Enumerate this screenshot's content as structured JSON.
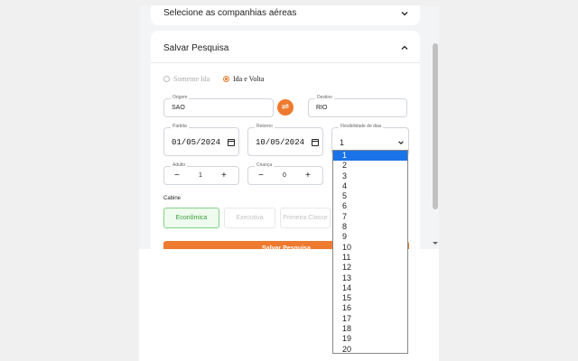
{
  "airlines_section": {
    "title": "Selecione as companhias aéreas"
  },
  "save_section": {
    "title": "Salvar Pesquisa"
  },
  "trip_type": {
    "one_way": "Somente Ida",
    "round_trip": "Ida e Volta",
    "selected": "round_trip"
  },
  "origin": {
    "label": "Origem",
    "value": "SAO"
  },
  "destination": {
    "label": "Destino",
    "value": "RIO"
  },
  "swap_icon": "⇌",
  "departure": {
    "label": "Partida",
    "value": "01/05/2024"
  },
  "return": {
    "label": "Retorno",
    "value": "10/05/2024"
  },
  "flexibility": {
    "label": "Flexibilidade de dias",
    "value": "1",
    "options": [
      "1",
      "2",
      "3",
      "4",
      "5",
      "6",
      "7",
      "8",
      "9",
      "10",
      "11",
      "12",
      "13",
      "14",
      "15",
      "16",
      "17",
      "18",
      "19",
      "20"
    ],
    "selected_index": 0
  },
  "adults": {
    "label": "Adulto",
    "value": "1",
    "minus": "−",
    "plus": "+"
  },
  "children": {
    "label": "Criança",
    "value": "0",
    "minus": "−",
    "plus": "+"
  },
  "cabin": {
    "label": "Cabine",
    "options": [
      "Econômica",
      "Executiva",
      "Primeira Classe"
    ],
    "selected": "Econômica"
  },
  "save_button": {
    "label": "Salvar Pesquisa"
  },
  "colors": {
    "accent": "#ee7a2f",
    "selected_option": "#1a73e8",
    "cabin_active": "#3a9a3a"
  }
}
